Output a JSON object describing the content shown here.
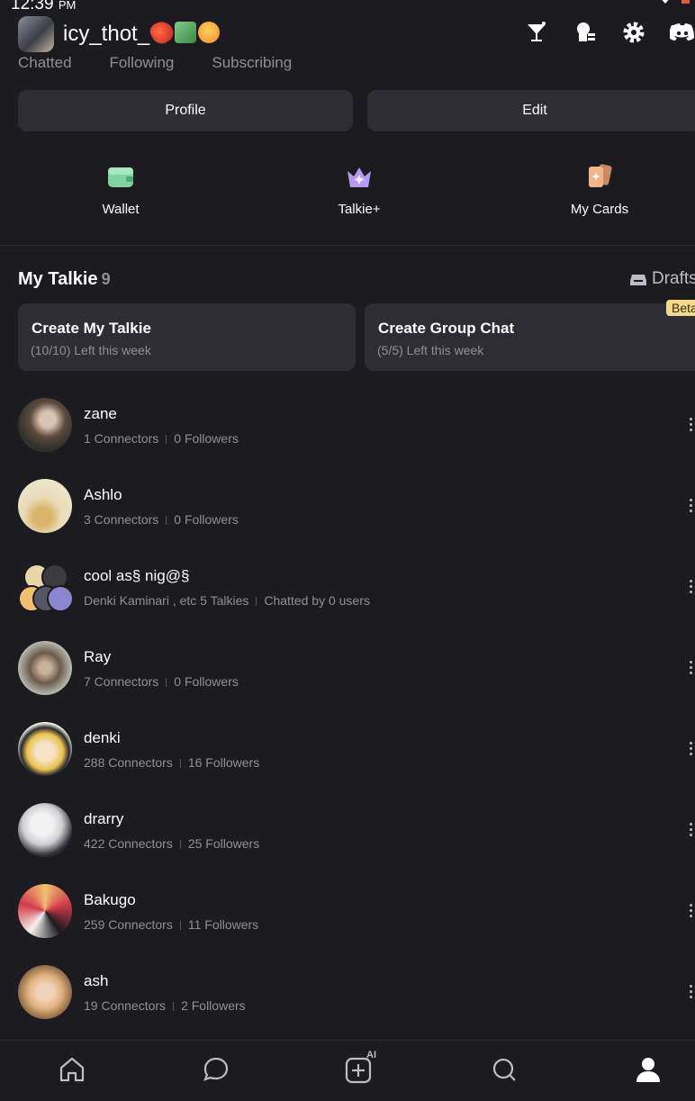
{
  "status_bar": {
    "time": "12:39",
    "ampm": "PM"
  },
  "header": {
    "username": "icy_thot_",
    "emojis": [
      "chili-pepper-emoji",
      "money-wings-emoji",
      "hot-face-emoji"
    ]
  },
  "tabs": [
    "Chatted",
    "Following",
    "Subscribing"
  ],
  "buttons": {
    "profile": "Profile",
    "edit": "Edit"
  },
  "quick_actions": [
    {
      "label": "Wallet",
      "icon": "wallet-icon"
    },
    {
      "label": "Talkie+",
      "icon": "crown-icon"
    },
    {
      "label": "My Cards",
      "icon": "cards-icon"
    }
  ],
  "my_talkie": {
    "title": "My Talkie",
    "count": "9",
    "drafts": "Drafts"
  },
  "create_cards": [
    {
      "title": "Create My Talkie",
      "subtitle": "(10/10) Left this week"
    },
    {
      "title": "Create Group Chat",
      "subtitle": "(5/5) Left this week",
      "badge": "Beta"
    }
  ],
  "talkies": [
    {
      "name": "zane",
      "stat1": "1 Connectors",
      "stat2": "0 Followers"
    },
    {
      "name": "Ashlo",
      "stat1": "3 Connectors",
      "stat2": "0 Followers"
    },
    {
      "name": "cool as§ nig@§",
      "stat1": "Denki Kaminari , etc 5 Talkies",
      "stat2": "Chatted by 0 users"
    },
    {
      "name": "Ray",
      "stat1": "7 Connectors",
      "stat2": "0 Followers"
    },
    {
      "name": "denki",
      "stat1": "288 Connectors",
      "stat2": "16 Followers"
    },
    {
      "name": "drarry",
      "stat1": "422 Connectors",
      "stat2": "25 Followers"
    },
    {
      "name": "Bakugo",
      "stat1": "259 Connectors",
      "stat2": "11 Followers"
    },
    {
      "name": "ash",
      "stat1": "19 Connectors",
      "stat2": "2 Followers"
    }
  ],
  "bottom_nav": {
    "ai_label": "AI"
  },
  "colors": {
    "background": "#1b1b20",
    "card": "#2d2d33",
    "muted_text": "#8f8f96",
    "beta_badge": "#f5d98a"
  }
}
